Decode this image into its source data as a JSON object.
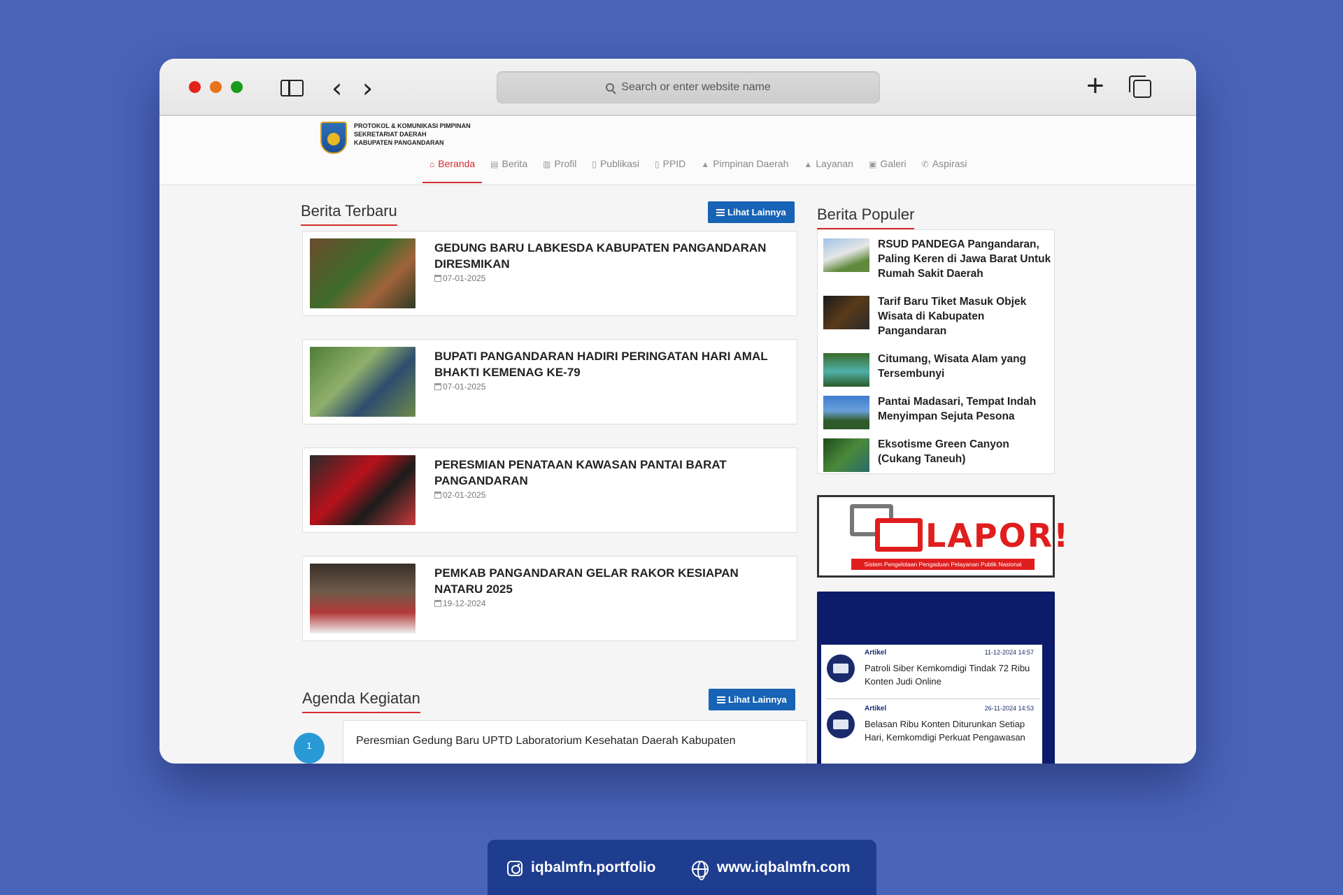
{
  "browser": {
    "address_placeholder": "Search or enter website name"
  },
  "site": {
    "brand_lines": [
      "PROTOKOL & KOMUNIKASI PIMPINAN",
      "SEKRETARIAT DAERAH",
      "KABUPATEN PANGANDARAN"
    ],
    "nav": [
      {
        "label": "Beranda",
        "icon": "home-icon",
        "active": true
      },
      {
        "label": "Berita",
        "icon": "newspaper-icon"
      },
      {
        "label": "Profil",
        "icon": "institution-icon"
      },
      {
        "label": "Publikasi",
        "icon": "file-icon"
      },
      {
        "label": "PPID",
        "icon": "file-icon"
      },
      {
        "label": "Pimpinan Daerah",
        "icon": "thumbs-up-icon"
      },
      {
        "label": "Layanan",
        "icon": "thumbs-up-icon"
      },
      {
        "label": "Galeri",
        "icon": "image-icon"
      },
      {
        "label": "Aspirasi",
        "icon": "phone-icon"
      }
    ]
  },
  "latest_news": {
    "title": "Berita Terbaru",
    "more_label": "Lihat Lainnya",
    "items": [
      {
        "title": "GEDUNG BARU LABKESDA KABUPATEN PANGANDARAN DIRESMIKAN",
        "date": "07-01-2025"
      },
      {
        "title": "BUPATI PANGANDARAN HADIRI PERINGATAN HARI AMAL BHAKTI KEMENAG KE-79",
        "date": "07-01-2025"
      },
      {
        "title": "PERESMIAN PENATAAN KAWASAN PANTAI BARAT PANGANDARAN",
        "date": "02-01-2025"
      },
      {
        "title": "PEMKAB PANGANDARAN GELAR RAKOR KESIAPAN NATARU 2025",
        "date": "19-12-2024"
      }
    ]
  },
  "agenda": {
    "title": "Agenda Kegiatan",
    "more_label": "Lihat Lainnya",
    "items": [
      {
        "number": "1",
        "title": "Peresmian Gedung Baru UPTD Laboratorium Kesehatan Daerah Kabupaten"
      }
    ]
  },
  "popular": {
    "title": "Berita Populer",
    "items": [
      {
        "title": "RSUD PANDEGA Pangandaran, Paling Keren di Jawa Barat Untuk Rumah Sakit Daerah"
      },
      {
        "title": "Tarif Baru Tiket Masuk Objek Wisata di Kabupaten Pangandaran"
      },
      {
        "title": "Citumang, Wisata Alam yang Tersembunyi"
      },
      {
        "title": "Pantai Madasari, Tempat Indah Menyimpan Sejuta Pesona"
      },
      {
        "title": "Eksotisme Green Canyon (Cukang Taneuh)"
      }
    ]
  },
  "lapor": {
    "word": "LAPOR!",
    "tagline": "Sistem Pengelolaan Pengaduan Pelayanan Publik Nasional"
  },
  "feed": {
    "items": [
      {
        "category": "Artikel",
        "time": "11-12-2024 14:57",
        "text": "Patroli Siber Kemkomdigi Tindak 72 Ribu Konten Judi Online"
      },
      {
        "category": "Artikel",
        "time": "26-11-2024 14:53",
        "text": "Belasan Ribu Konten Diturunkan Setiap Hari, Kemkomdigi Perkuat Pengawasan"
      }
    ]
  },
  "footer": {
    "instagram": "iqbalmfn.portfolio",
    "website": "www.iqbalmfn.com"
  },
  "colors": {
    "background": "#4a64b8",
    "accent_red": "#d62b2b",
    "button_blue": "#1763b5",
    "footer_bar": "#1f3d8f",
    "feed_navy": "#0c1c6b"
  }
}
